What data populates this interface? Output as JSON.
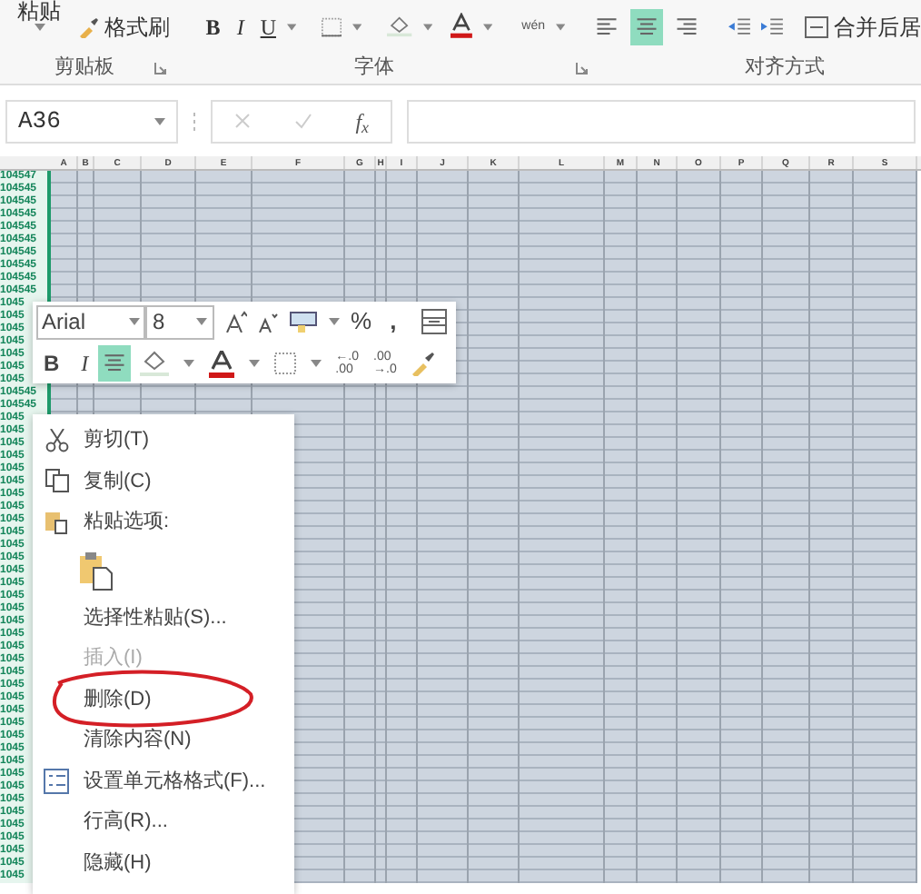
{
  "ribbon": {
    "paste_label": "粘贴",
    "format_painter": "格式刷",
    "font_buttons": [
      {
        "label": "B",
        "kind": "bold"
      },
      {
        "label": "I",
        "kind": "italic"
      },
      {
        "label": "U",
        "kind": "underline"
      }
    ],
    "phonetic": "wén",
    "align": [
      {
        "kind": "left",
        "selected": false
      },
      {
        "kind": "center",
        "selected": true
      },
      {
        "kind": "right",
        "selected": false
      }
    ],
    "merge_label": "合并后居",
    "groups": [
      {
        "label": "剪贴板",
        "launcher": true
      },
      {
        "label": "字体",
        "launcher": true
      },
      {
        "label": "对齐方式",
        "launcher": false
      }
    ]
  },
  "formula_bar": {
    "name_box": "A36",
    "fx": "f$_{x}$"
  },
  "columns": [
    "A",
    "B",
    "C",
    "D",
    "E",
    "F",
    "G",
    "H",
    "I",
    "J",
    "K",
    "L",
    "M",
    "N",
    "O",
    "P",
    "Q",
    "R",
    "S"
  ],
  "rows": [
    "104547",
    "104545",
    "104545",
    "104545",
    "104545",
    "104545",
    "104545",
    "104545",
    "104545",
    "104545",
    "1045",
    "1045",
    "1045",
    "1045",
    "1045",
    "1045",
    "1045",
    "104545",
    "104545",
    "1045",
    "1045",
    "1045",
    "1045",
    "1045",
    "1045",
    "1045",
    "1045",
    "1045",
    "1045",
    "1045",
    "1045",
    "1045",
    "1045",
    "1045",
    "1045",
    "1045",
    "1045",
    "1045",
    "1045",
    "1045",
    "1045",
    "1045",
    "1045",
    "1045",
    "1045",
    "1045",
    "1045",
    "1045",
    "1045",
    "1045",
    "1045",
    "1045",
    "1045",
    "1045",
    "1045",
    "1045"
  ],
  "mini_toolbar": {
    "bold": "B",
    "italic": "I",
    "font": "Arial",
    "size": "8",
    "percent": "%",
    "comma": ",",
    "center_selected": true,
    "decimals": [
      {
        "top": "←.0",
        "bottom": ".00"
      },
      {
        "top": ".00",
        "bottom": "→.0"
      }
    ]
  },
  "context_menu": {
    "items": [
      {
        "kind": "cut",
        "label": "剪切(T)",
        "disabled": false,
        "circled": false
      },
      {
        "kind": "copy",
        "label": "复制(C)",
        "disabled": false,
        "circled": false
      },
      {
        "kind": "paste_header",
        "label": "粘贴选项:",
        "disabled": false,
        "circled": false
      },
      {
        "kind": "paste_button"
      },
      {
        "kind": "plain",
        "label": "选择性粘贴(S)...",
        "disabled": false,
        "circled": false
      },
      {
        "kind": "plain",
        "label": "插入(I)",
        "disabled": true,
        "circled": false
      },
      {
        "kind": "plain",
        "label": "删除(D)",
        "disabled": false,
        "circled": true
      },
      {
        "kind": "plain",
        "label": "清除内容(N)",
        "disabled": false,
        "circled": false
      },
      {
        "kind": "format_cells",
        "label": "设置单元格格式(F)...",
        "disabled": false,
        "circled": false
      },
      {
        "kind": "plain",
        "label": "行高(R)...",
        "disabled": false,
        "circled": false
      },
      {
        "kind": "plain",
        "label": "隐藏(H)",
        "disabled": false,
        "circled": false
      }
    ]
  }
}
